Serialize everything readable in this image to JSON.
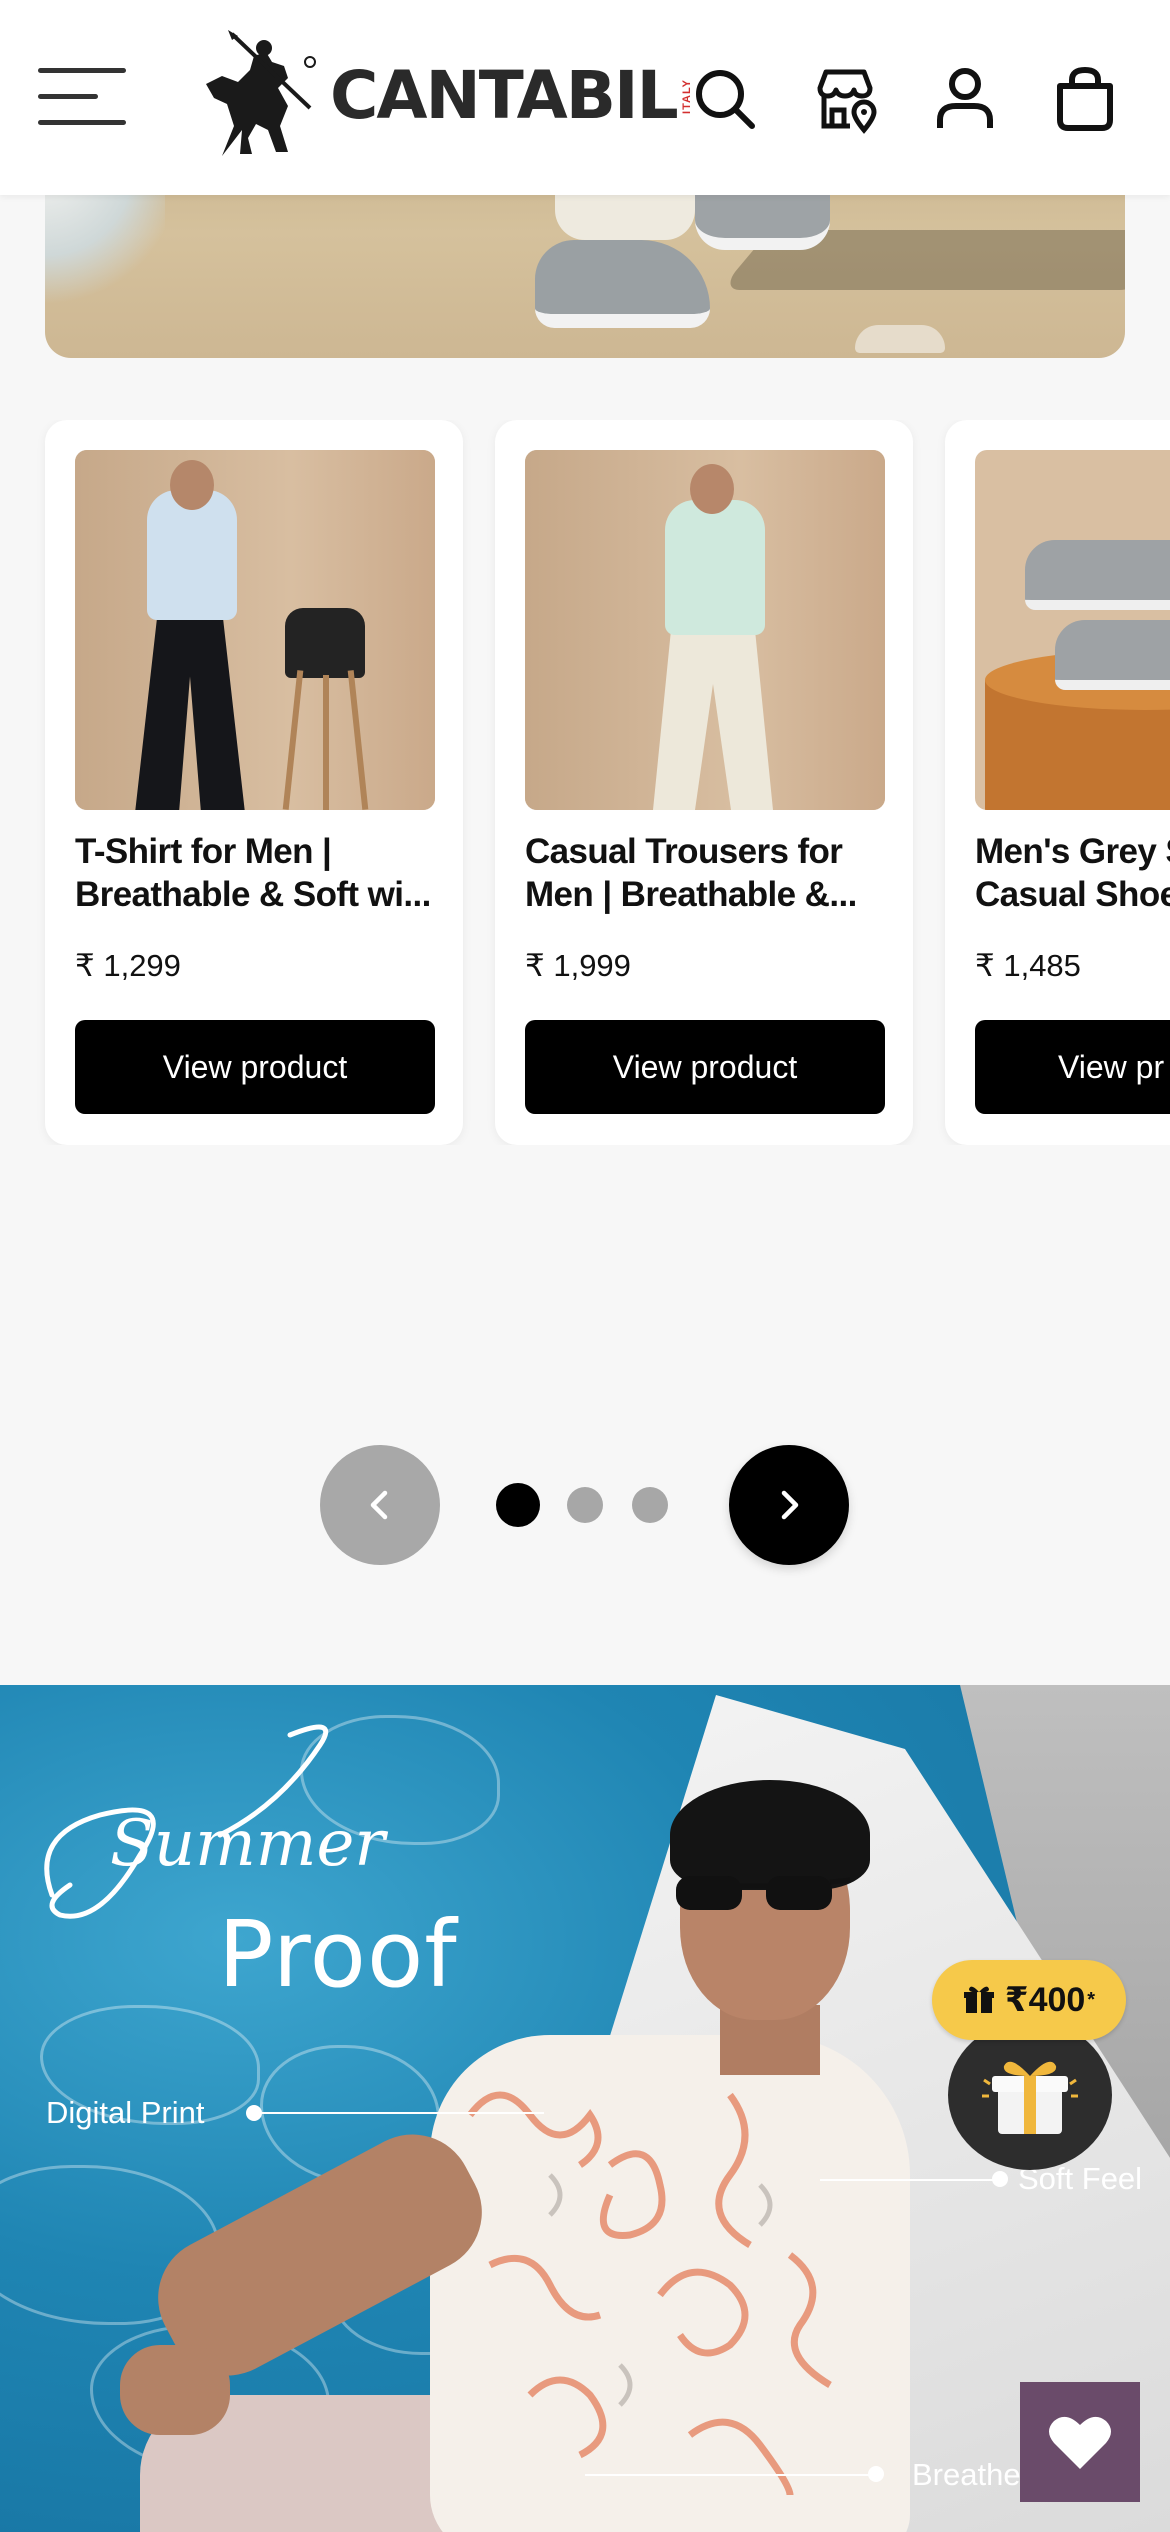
{
  "header": {
    "brand": "CANTABIL",
    "brand_tag": "ITALY",
    "icons": [
      "menu-icon",
      "search-icon",
      "store-locator-icon",
      "user-icon",
      "bag-icon"
    ]
  },
  "products": [
    {
      "title": "T-Shirt for Men |\nBreathable & Soft wi...",
      "price": "₹ 1,299",
      "button": "View product"
    },
    {
      "title": "Casual Trousers for\nMen | Breathable &...",
      "price": "₹ 1,999",
      "button": "View product"
    },
    {
      "title": "Men's Grey S\nCasual Shoe",
      "price": "₹ 1,485",
      "button": "View pr"
    }
  ],
  "pager": {
    "active_index": 0,
    "total": 3
  },
  "summer_banner": {
    "script_word": "Summer",
    "headline": "Proof",
    "features": [
      "Digital Print",
      "Soft Feel",
      "Breathe"
    ]
  },
  "gift": {
    "amount": "₹400",
    "asterisk": "*"
  },
  "colors": {
    "black": "#000000",
    "pager_inactive": "#a8a8a8",
    "gift_pill": "#f6c94a",
    "wishlist_bg": "#6a4b6a"
  }
}
